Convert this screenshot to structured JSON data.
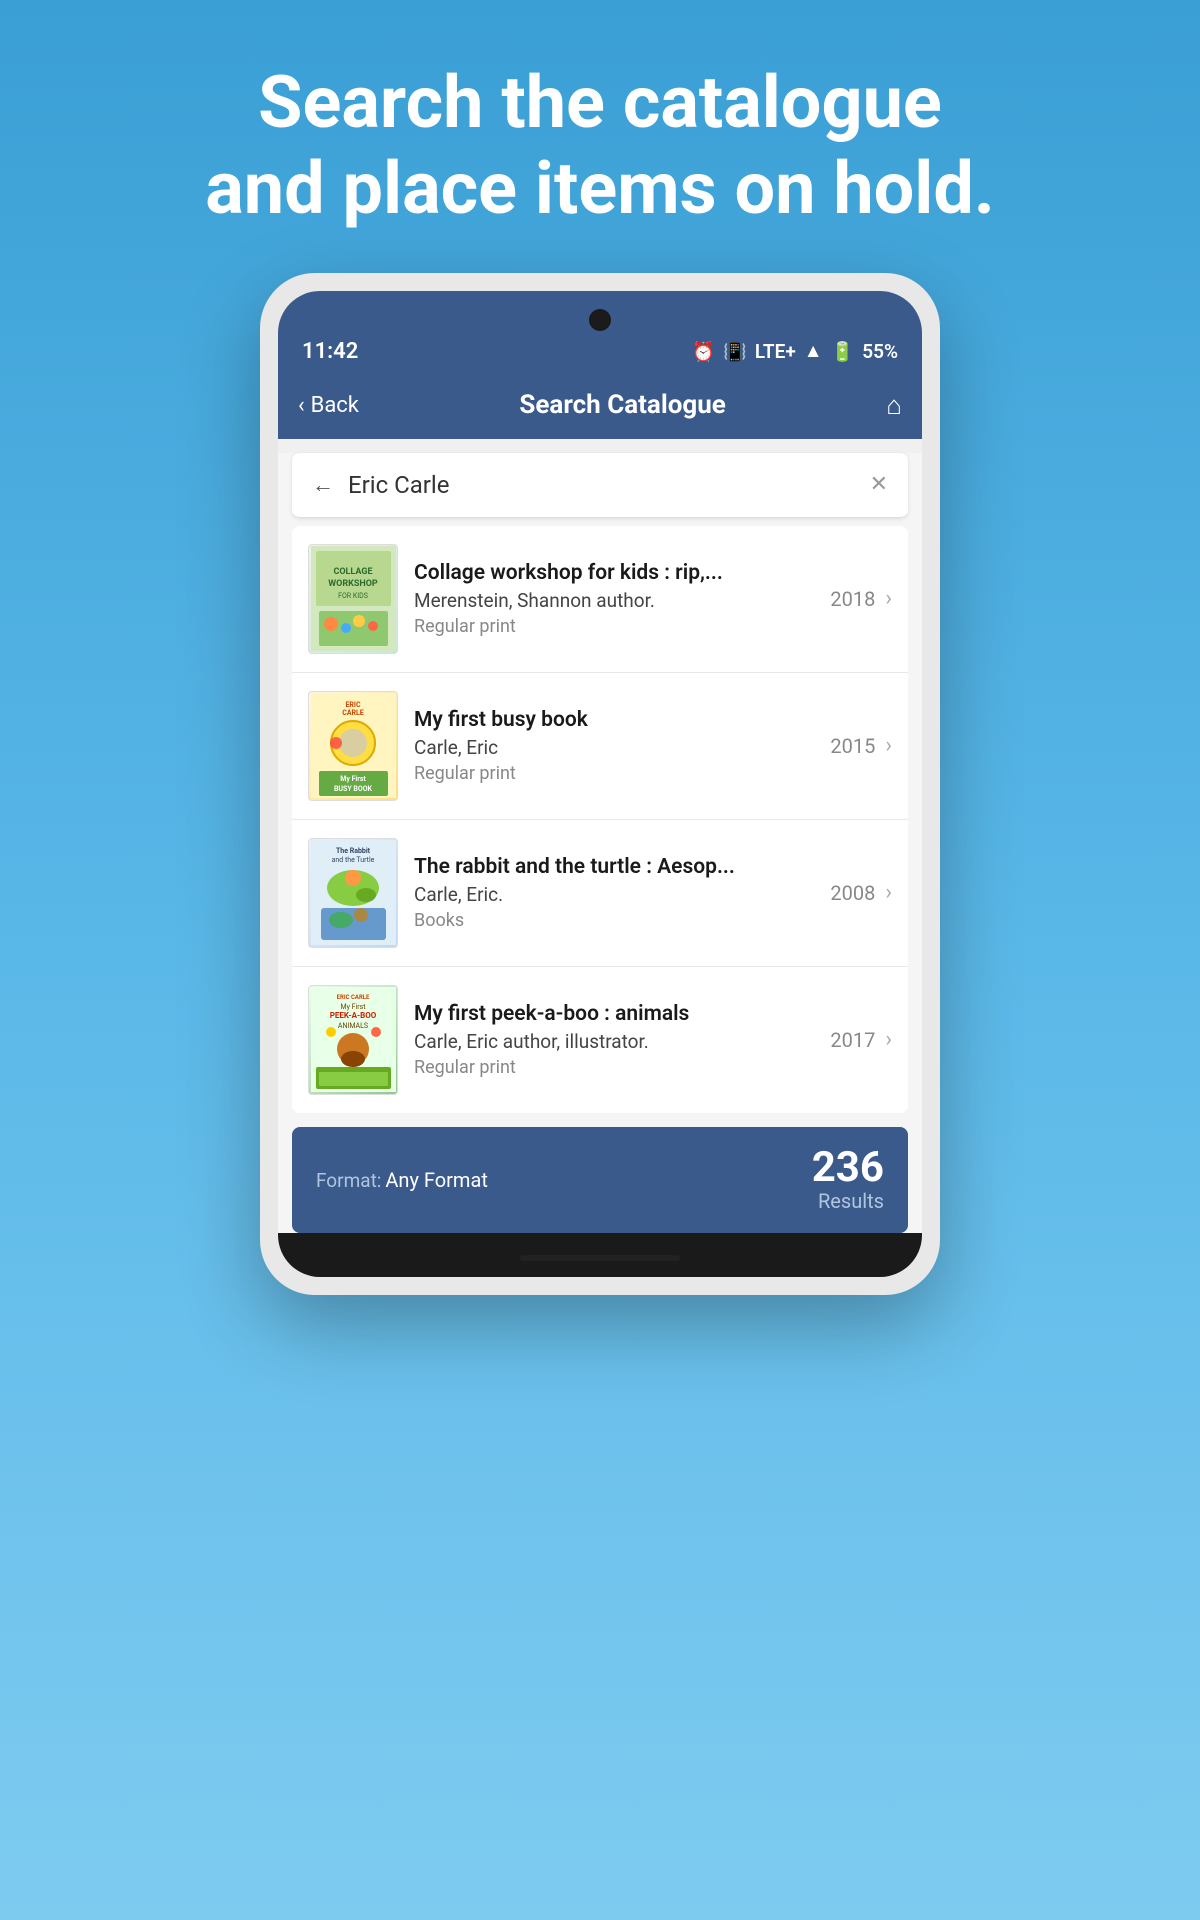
{
  "hero": {
    "line1": "Search the catalogue",
    "line2": "and place items on hold."
  },
  "status_bar": {
    "time": "11:42",
    "signal": "LTE+",
    "battery": "55%"
  },
  "nav": {
    "back_label": "Back",
    "title": "Search Catalogue",
    "home_icon": "🏠"
  },
  "search": {
    "query": "Eric Carle",
    "clear_icon": "✕",
    "back_icon": "←"
  },
  "results": [
    {
      "title": "Collage workshop for kids : rip,...",
      "author": "Merenstein, Shannon author.",
      "format": "Regular print",
      "year": "2018",
      "cover_type": "1"
    },
    {
      "title": "My first busy book",
      "author": "Carle, Eric",
      "format": "Regular print",
      "year": "2015",
      "cover_type": "2"
    },
    {
      "title": "The rabbit and the turtle : Aesop...",
      "author": "Carle, Eric.",
      "format": "Books",
      "year": "2008",
      "cover_type": "3"
    },
    {
      "title": "My first peek-a-boo : animals",
      "author": "Carle, Eric author, illustrator.",
      "format": "Regular print",
      "year": "2017",
      "cover_type": "4"
    }
  ],
  "footer": {
    "format_label": "Format:",
    "format_value": "Any Format",
    "count": "236",
    "results_label": "Results"
  }
}
